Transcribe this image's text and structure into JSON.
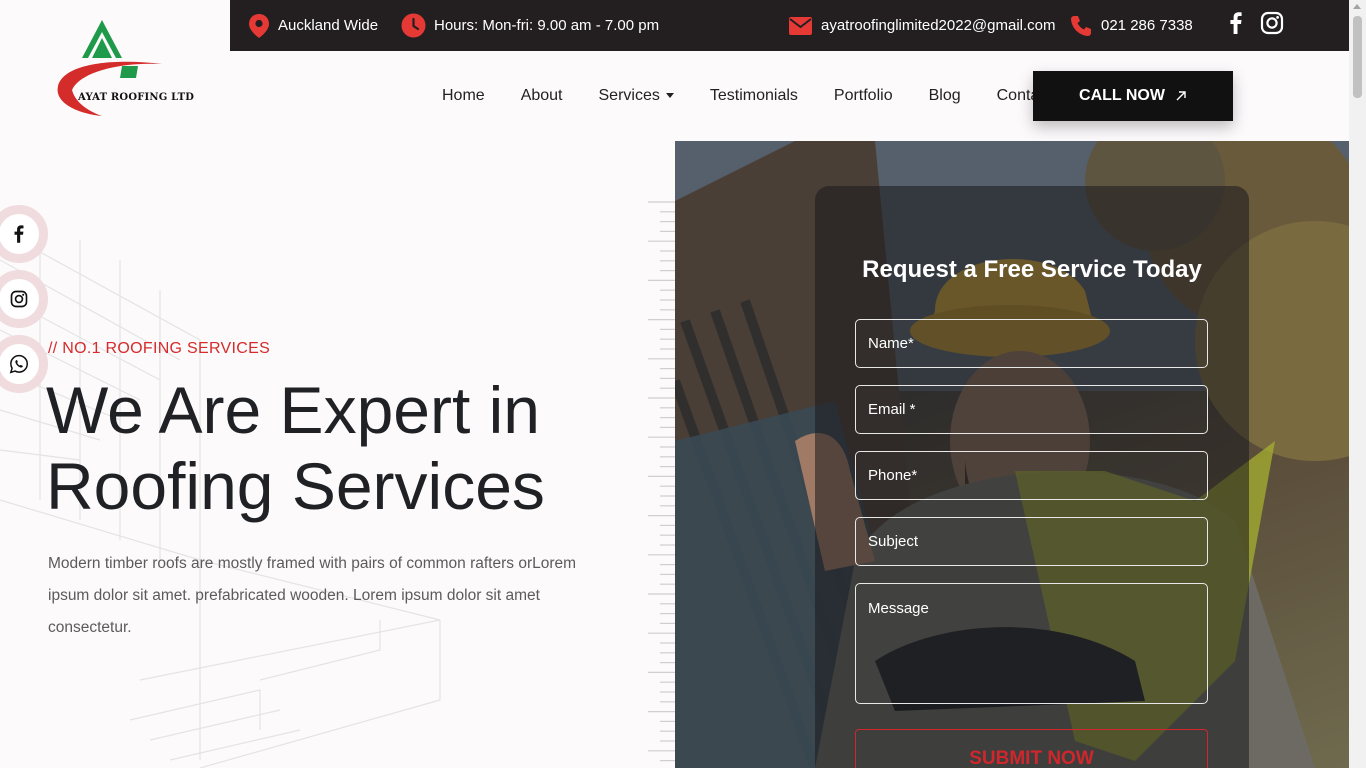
{
  "brand": {
    "logo_text": "AYAT ROOFING LTD"
  },
  "topbar": {
    "location": "Auckland Wide",
    "hours": "Hours: Mon-fri: 9.00 am - 7.00 pm",
    "email": "ayatroofinglimited2022@gmail.com",
    "phone": "021 286 7338"
  },
  "nav": {
    "items": [
      "Home",
      "About",
      "Services",
      "Testimonials",
      "Portfolio",
      "Blog",
      "Contact"
    ],
    "cta": "CALL NOW"
  },
  "hero": {
    "kicker": "// NO.1 ROOFING SERVICES",
    "title_line1": "We Are Expert in",
    "title_line2": "Roofing Services",
    "description": "Modern timber roofs are mostly framed with pairs of common rafters orLorem ipsum dolor sit amet. prefabricated wooden. Lorem ipsum dolor sit amet consectetur."
  },
  "form": {
    "title": "Request a Free Service Today",
    "name_placeholder": "Name*",
    "email_placeholder": "Email *",
    "phone_placeholder": "Phone*",
    "subject_placeholder": "Subject",
    "message_placeholder": "Message",
    "submit": "SUBMIT NOW"
  },
  "colors": {
    "accent": "#d42b2b",
    "dark": "#231f20",
    "green": "#1f9a4a"
  },
  "icons": [
    "location-pin-icon",
    "clock-icon",
    "mail-icon",
    "phone-icon",
    "facebook-icon",
    "instagram-icon",
    "whatsapp-icon",
    "arrow-up-right-icon"
  ]
}
